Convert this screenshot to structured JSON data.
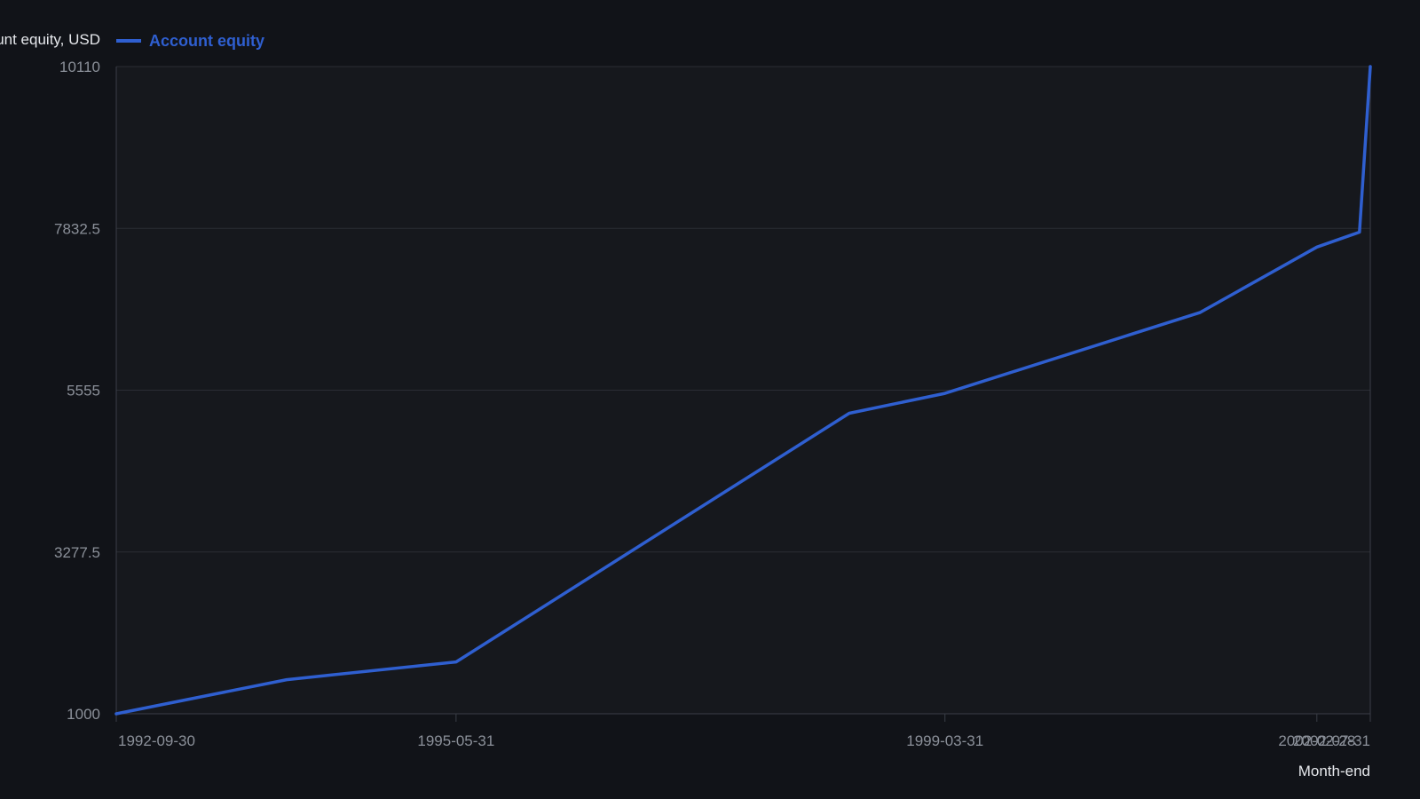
{
  "chart_data": {
    "type": "line",
    "ylabel": "Account equity, USD",
    "xlabel": "Month-end",
    "ylim": [
      1000,
      10110
    ],
    "y_ticks": [
      "1000",
      "3277.5",
      "5555",
      "7832.5",
      "10110"
    ],
    "x_tick_labels": [
      "1992-09-30",
      "1995-05-31",
      "1999-03-31",
      "2002-02-28",
      "2002-07-31"
    ],
    "grid": true,
    "legend_position": "top-left",
    "series": [
      {
        "name": "Account equity",
        "color": "#2f5fd0",
        "x": [
          "1992-09-30",
          "1994-01-31",
          "1995-05-31",
          "1998-06-30",
          "1999-03-31",
          "2001-03-31",
          "2002-02-28",
          "2002-06-30",
          "2002-07-31"
        ],
        "y": [
          1000,
          1480,
          1730,
          5230,
          5510,
          6650,
          7570,
          7780,
          10110
        ]
      }
    ]
  }
}
